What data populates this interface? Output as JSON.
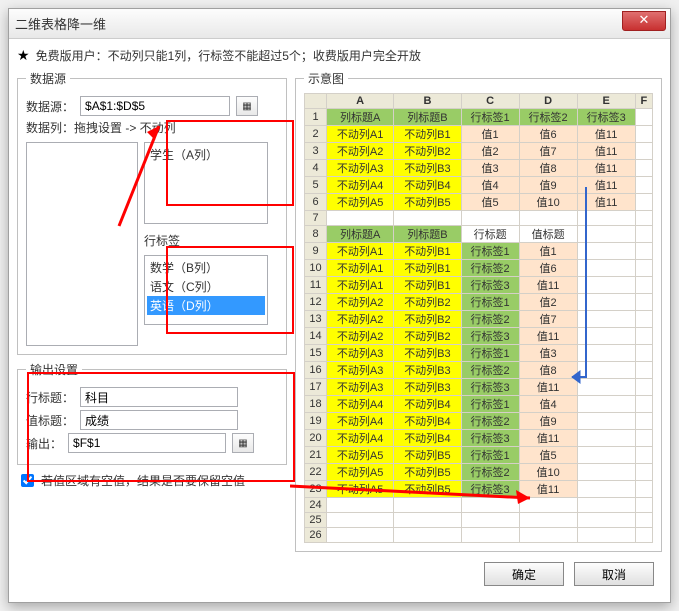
{
  "window": {
    "title": "二维表格降一维"
  },
  "notice": "免费版用户：不动列只能1列，行标签不能超过5个；收费版用户完全开放",
  "panels": {
    "data_source": "数据源",
    "output_settings": "输出设置",
    "preview": "示意图"
  },
  "fields": {
    "data_source_label": "数据源：",
    "data_source_value": "$A$1:$D$5",
    "data_col_help": "数据列：拖拽设置 -> 不动列",
    "row_header_label": "行标签",
    "row_title_label": "行标题：",
    "row_title_value": "科目",
    "value_title_label": "值标题：",
    "value_title_value": "成绩",
    "output_label": "输出：",
    "output_value": "$F$1"
  },
  "lists": {
    "fixed_cols": [
      "学生（A列）"
    ],
    "row_labels": [
      "数学（B列）",
      "语文（C列）",
      "英语（D列）"
    ]
  },
  "checkbox": {
    "label": "若值区域有空值，结果是否要保留空值"
  },
  "buttons": {
    "ok": "确定",
    "cancel": "取消"
  },
  "grid_top": {
    "colhdrs": [
      "A",
      "B",
      "C",
      "D",
      "E",
      "F"
    ],
    "rows": [
      {
        "n": 1,
        "a": "列标题A",
        "b": "列标题B",
        "c": "行标签1",
        "d": "行标签2",
        "e": "行标签3",
        "f": ""
      },
      {
        "n": 2,
        "a": "不动列A1",
        "b": "不动列B1",
        "c": "值1",
        "d": "值6",
        "e": "值11",
        "f": ""
      },
      {
        "n": 3,
        "a": "不动列A2",
        "b": "不动列B2",
        "c": "值2",
        "d": "值7",
        "e": "值11",
        "f": ""
      },
      {
        "n": 4,
        "a": "不动列A3",
        "b": "不动列B3",
        "c": "值3",
        "d": "值8",
        "e": "值11",
        "f": ""
      },
      {
        "n": 5,
        "a": "不动列A4",
        "b": "不动列B4",
        "c": "值4",
        "d": "值9",
        "e": "值11",
        "f": ""
      },
      {
        "n": 6,
        "a": "不动列A5",
        "b": "不动列B5",
        "c": "值5",
        "d": "值10",
        "e": "值11",
        "f": ""
      }
    ]
  },
  "grid_bottom_hdr": {
    "n": 8,
    "a": "列标题A",
    "b": "列标题B",
    "c": "行标题",
    "d": "值标题"
  },
  "grid_bottom": [
    {
      "n": 9,
      "a": "不动列A1",
      "b": "不动列B1",
      "c": "行标签1",
      "d": "值1"
    },
    {
      "n": 10,
      "a": "不动列A1",
      "b": "不动列B1",
      "c": "行标签2",
      "d": "值6"
    },
    {
      "n": 11,
      "a": "不动列A1",
      "b": "不动列B1",
      "c": "行标签3",
      "d": "值11"
    },
    {
      "n": 12,
      "a": "不动列A2",
      "b": "不动列B2",
      "c": "行标签1",
      "d": "值2"
    },
    {
      "n": 13,
      "a": "不动列A2",
      "b": "不动列B2",
      "c": "行标签2",
      "d": "值7"
    },
    {
      "n": 14,
      "a": "不动列A2",
      "b": "不动列B2",
      "c": "行标签3",
      "d": "值11"
    },
    {
      "n": 15,
      "a": "不动列A3",
      "b": "不动列B3",
      "c": "行标签1",
      "d": "值3"
    },
    {
      "n": 16,
      "a": "不动列A3",
      "b": "不动列B3",
      "c": "行标签2",
      "d": "值8"
    },
    {
      "n": 17,
      "a": "不动列A3",
      "b": "不动列B3",
      "c": "行标签3",
      "d": "值11"
    },
    {
      "n": 18,
      "a": "不动列A4",
      "b": "不动列B4",
      "c": "行标签1",
      "d": "值4"
    },
    {
      "n": 19,
      "a": "不动列A4",
      "b": "不动列B4",
      "c": "行标签2",
      "d": "值9"
    },
    {
      "n": 20,
      "a": "不动列A4",
      "b": "不动列B4",
      "c": "行标签3",
      "d": "值11"
    },
    {
      "n": 21,
      "a": "不动列A5",
      "b": "不动列B5",
      "c": "行标签1",
      "d": "值5"
    },
    {
      "n": 22,
      "a": "不动列A5",
      "b": "不动列B5",
      "c": "行标签2",
      "d": "值10"
    },
    {
      "n": 23,
      "a": "不动列A5",
      "b": "不动列B5",
      "c": "行标签3",
      "d": "值11"
    }
  ],
  "blank_rows": [
    7,
    24,
    25,
    26
  ]
}
